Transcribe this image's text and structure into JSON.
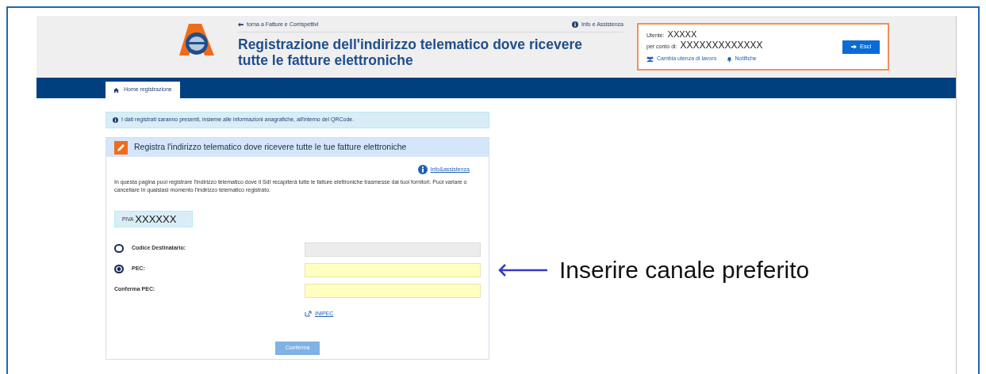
{
  "header": {
    "back_link": "torna a Fatture e Corrispettivi",
    "info_link": "Info e Assistenza",
    "title": "Registrazione dell'indirizzo telematico dove ricevere tutte le fatture elettroniche"
  },
  "user_box": {
    "user_label": "Utente:",
    "user": "XXXXX",
    "on_behalf_label": "per conto di:",
    "on_behalf": "XXXXXXXXXXXXX",
    "links": [
      {
        "label": "Cambia utenza di lavoro",
        "kind": "users"
      },
      {
        "label": "Notifiche",
        "kind": "bell"
      }
    ],
    "logout": "Esci"
  },
  "nav": {
    "tabs": [
      {
        "label": "Home registrazione",
        "selected": true
      }
    ]
  },
  "notice": "I dati registrati saranno presenti, insieme alle informazioni anagrafiche, all'interno del QRCode.",
  "panel": {
    "title": "Registra l'indirizzo telematico dove ricevere tutte le tue fatture elettroniche",
    "help_link": "Info&assistenza",
    "description": "In questa pagina puoi registrare l'indirizzo telematico dove il SdI recapiterà tutte le fatture elettroniche trasmesse dai tuoi fornitori. Puoi variare o cancellare in qualsiasi momento l'indirizzo telematico registrato.",
    "piva_label": "PIVA",
    "piva": "XXXXXX",
    "rows": [
      {
        "kind": "radio",
        "label": "Codice Destinatario:",
        "selected": false,
        "disabled": true
      },
      {
        "kind": "radio",
        "label": "PEC:",
        "selected": true,
        "disabled": false
      },
      {
        "kind": "plain",
        "label": "Conferma PEC:",
        "disabled": false
      }
    ],
    "inipec_link": "INIPEC",
    "submit": {
      "label": "Conferma",
      "disabled": true
    }
  },
  "annotation": "Inserire canale preferito"
}
